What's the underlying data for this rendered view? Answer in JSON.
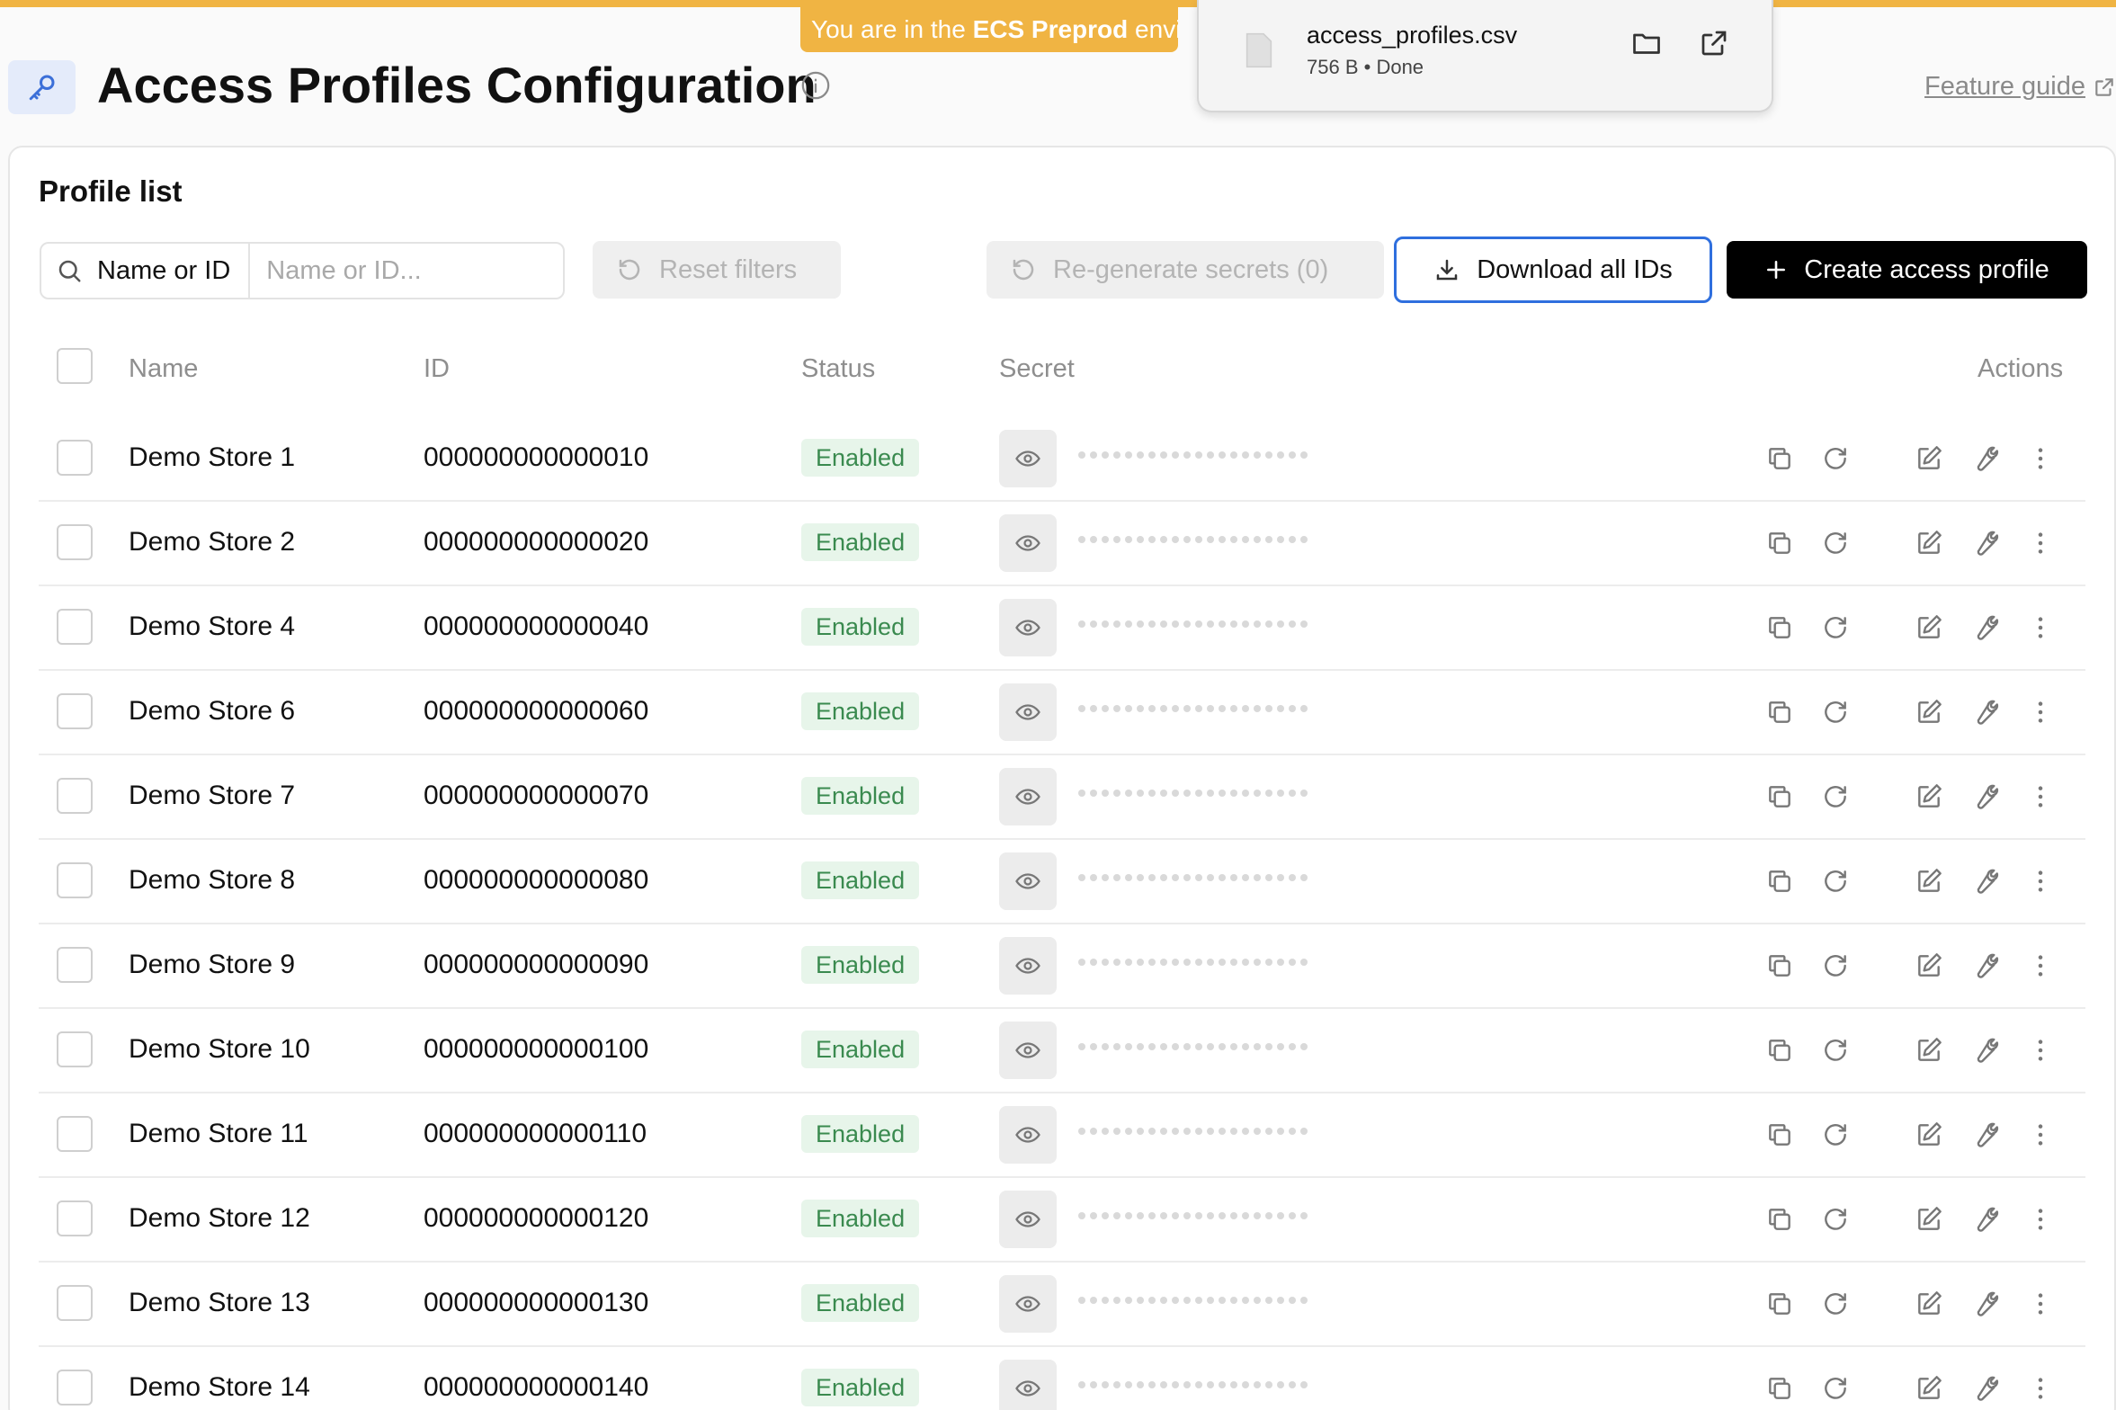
{
  "env_banner": {
    "prefix": "You are in the",
    "env_name": "ECS Preprod",
    "suffix": "environment"
  },
  "header": {
    "title": "Access Profiles Configuration",
    "feature_guide": "Feature guide"
  },
  "download_popup": {
    "file_name": "access_profiles.csv",
    "size": "756 B",
    "separator": "•",
    "status": "Done"
  },
  "profile_list": {
    "title": "Profile list",
    "search": {
      "label": "Name or ID",
      "placeholder": "Name or ID..."
    },
    "reset_filters": "Reset filters",
    "regenerate_secrets": "Re-generate secrets (0)",
    "download_all": "Download all IDs",
    "create_profile": "Create access profile"
  },
  "table": {
    "columns": {
      "name": "Name",
      "id": "ID",
      "status": "Status",
      "secret": "Secret",
      "actions": "Actions"
    },
    "rows": [
      {
        "name": "Demo Store 1",
        "id": "000000000000010",
        "status": "Enabled"
      },
      {
        "name": "Demo Store 2",
        "id": "000000000000020",
        "status": "Enabled"
      },
      {
        "name": "Demo Store 4",
        "id": "000000000000040",
        "status": "Enabled"
      },
      {
        "name": "Demo Store 6",
        "id": "000000000000060",
        "status": "Enabled"
      },
      {
        "name": "Demo Store 7",
        "id": "000000000000070",
        "status": "Enabled"
      },
      {
        "name": "Demo Store 8",
        "id": "000000000000080",
        "status": "Enabled"
      },
      {
        "name": "Demo Store 9",
        "id": "000000000000090",
        "status": "Enabled"
      },
      {
        "name": "Demo Store 10",
        "id": "000000000000100",
        "status": "Enabled"
      },
      {
        "name": "Demo Store 11",
        "id": "000000000000110",
        "status": "Enabled"
      },
      {
        "name": "Demo Store 12",
        "id": "000000000000120",
        "status": "Enabled"
      },
      {
        "name": "Demo Store 13",
        "id": "000000000000130",
        "status": "Enabled"
      },
      {
        "name": "Demo Store 14",
        "id": "000000000000140",
        "status": "Enabled"
      }
    ]
  },
  "colors": {
    "banner": "#f0b443",
    "accent_blue": "#2f6fde",
    "enabled_bg": "#e7f5ea",
    "enabled_text": "#3a8a4f"
  },
  "icons": [
    "key-icon",
    "info-icon",
    "external-link-icon",
    "search-icon",
    "reset-icon",
    "download-icon",
    "plus-icon",
    "eye-icon",
    "copy-icon",
    "refresh-icon",
    "edit-icon",
    "wrench-icon",
    "more-icon",
    "file-icon",
    "folder-icon"
  ]
}
